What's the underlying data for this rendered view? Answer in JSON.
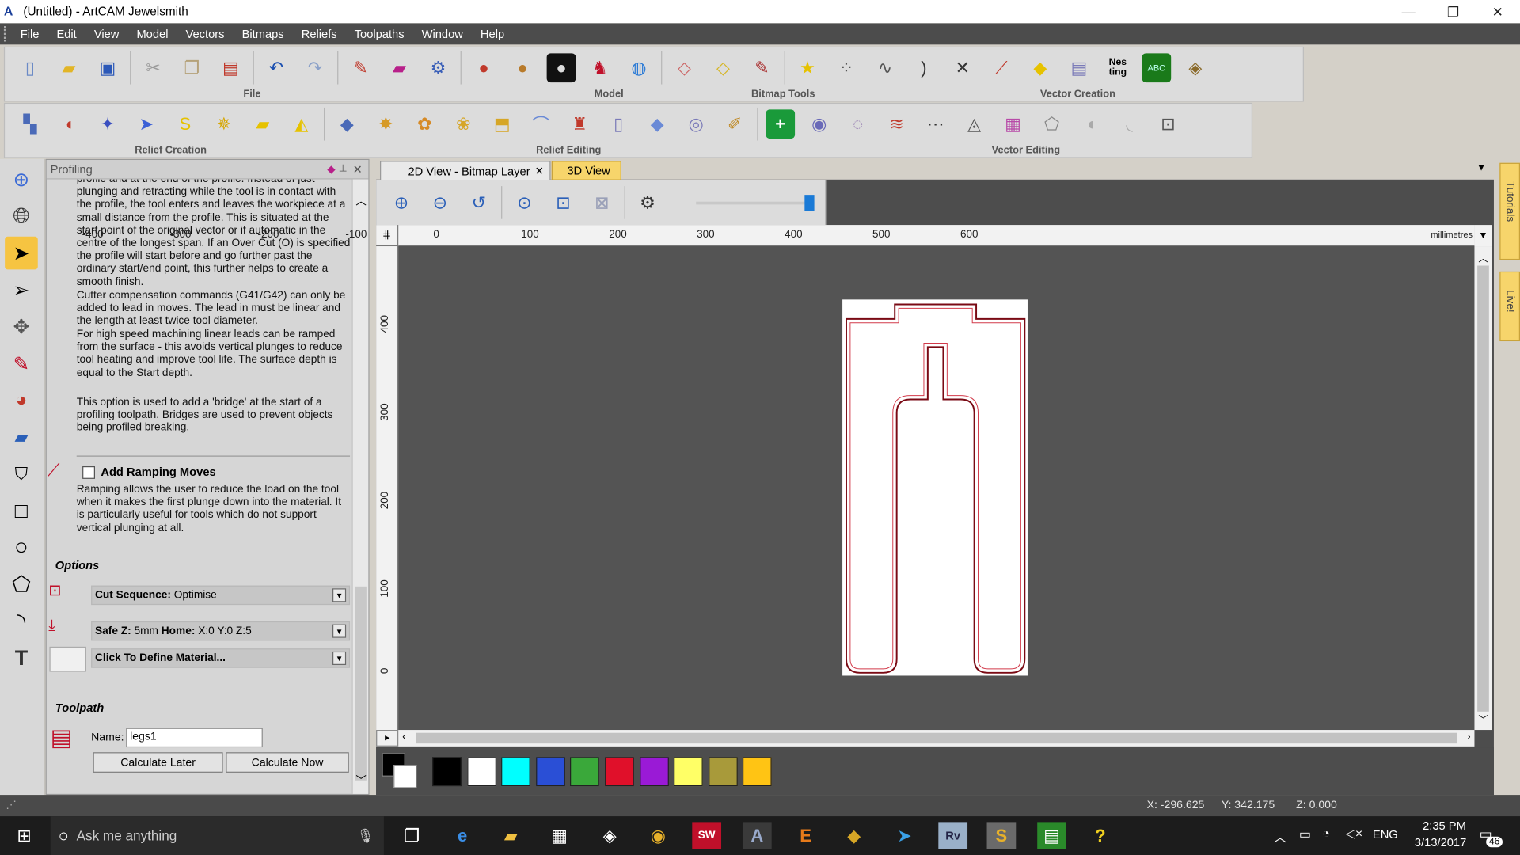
{
  "window": {
    "title": "(Untitled) - ArtCAM Jewelsmith",
    "app_icon": "artcam-icon",
    "controls": [
      "—",
      "❐",
      "✕"
    ]
  },
  "menu": [
    "File",
    "Edit",
    "View",
    "Model",
    "Vectors",
    "Bitmaps",
    "Reliefs",
    "Toolpaths",
    "Window",
    "Help"
  ],
  "toolbars": {
    "row1_labels": [
      "File",
      "Model",
      "Bitmap Tools",
      "Vector Creation"
    ],
    "row2_labels": [
      "Relief Creation",
      "Relief Editing",
      "Vector Editing"
    ],
    "nesting_icon_text": "Nes ting"
  },
  "panel": {
    "title": "Profiling",
    "help_paragraphs": [
      "profile and at the end of the profile. Instead of just plunging and retracting while the tool is in contact with the profile, the tool enters and leaves the workpiece at a small distance from the profile. This is situated at the start point of the original vector or if automatic in the centre of the longest span. If an Over Cut (O) is specified the profile will start before and go further past the ordinary start/end point, this further helps to create a smooth finish.",
      "Cutter compensation commands (G41/G42) can only be added to lead in moves. The lead in must be linear and the length at least twice tool diameter.",
      "For high speed machining linear leads can be ramped from the surface - this avoids vertical plunges to reduce tool heating and improve tool life. The surface depth is equal to the Start depth.",
      "This option is used to add a 'bridge' at the start of a profiling toolpath. Bridges are used to prevent objects being profiled breaking."
    ],
    "ramping_label": "Add Ramping Moves",
    "ramping_checked": false,
    "ramping_help": "Ramping allows the user to reduce the load on the tool when it makes the first plunge down into the material. It is particularly useful for tools which do not support vertical plunging at all.",
    "options_heading": "Options",
    "cut_sequence_label": "Cut Sequence:",
    "cut_sequence_value": "Optimise",
    "safe_z_label": "Safe Z:",
    "safe_z_value": "5mm",
    "home_label": "Home:",
    "home_value": "X:0 Y:0 Z:5",
    "material_label": "Click To Define Material...",
    "toolpath_heading": "Toolpath",
    "name_label": "Name:",
    "name_value": "legs1",
    "calc_later": "Calculate Later",
    "calc_now": "Calculate Now"
  },
  "view": {
    "tab_2d": "2D View - Bitmap Layer",
    "tab_3d": "3D View",
    "zoom_slider_level": 1.0,
    "ruler_units": "millimetres",
    "h_ticks": [
      "-400",
      "-300",
      "-200",
      "-100",
      "0",
      "100",
      "200",
      "300",
      "400",
      "500",
      "600"
    ],
    "v_ticks": [
      "400",
      "300",
      "200",
      "100",
      "0"
    ]
  },
  "palette": {
    "colors": [
      "#000000",
      "#ffffff",
      "#00ffff",
      "#2a4fd6",
      "#3aa83a",
      "#e0102a",
      "#9a1ad6",
      "#ffff66",
      "#a89a3a",
      "#ffc414"
    ]
  },
  "status": {
    "x": "X: -296.625",
    "y": "Y: 342.175",
    "z": "Z: 0.000"
  },
  "taskbar": {
    "search_placeholder": "Ask me anything",
    "lang": "ENG",
    "time": "2:35 PM",
    "date": "3/13/2017",
    "notif_count": "46",
    "apps": [
      "task-view",
      "edge",
      "file-explorer",
      "store",
      "dropbox",
      "chrome",
      "solidworks",
      "artcam",
      "e-app",
      "git-app",
      "telegram",
      "revit",
      "s-app",
      "green-app",
      "help-app"
    ]
  },
  "right_tabs": [
    "Tutorials",
    "Live!"
  ]
}
